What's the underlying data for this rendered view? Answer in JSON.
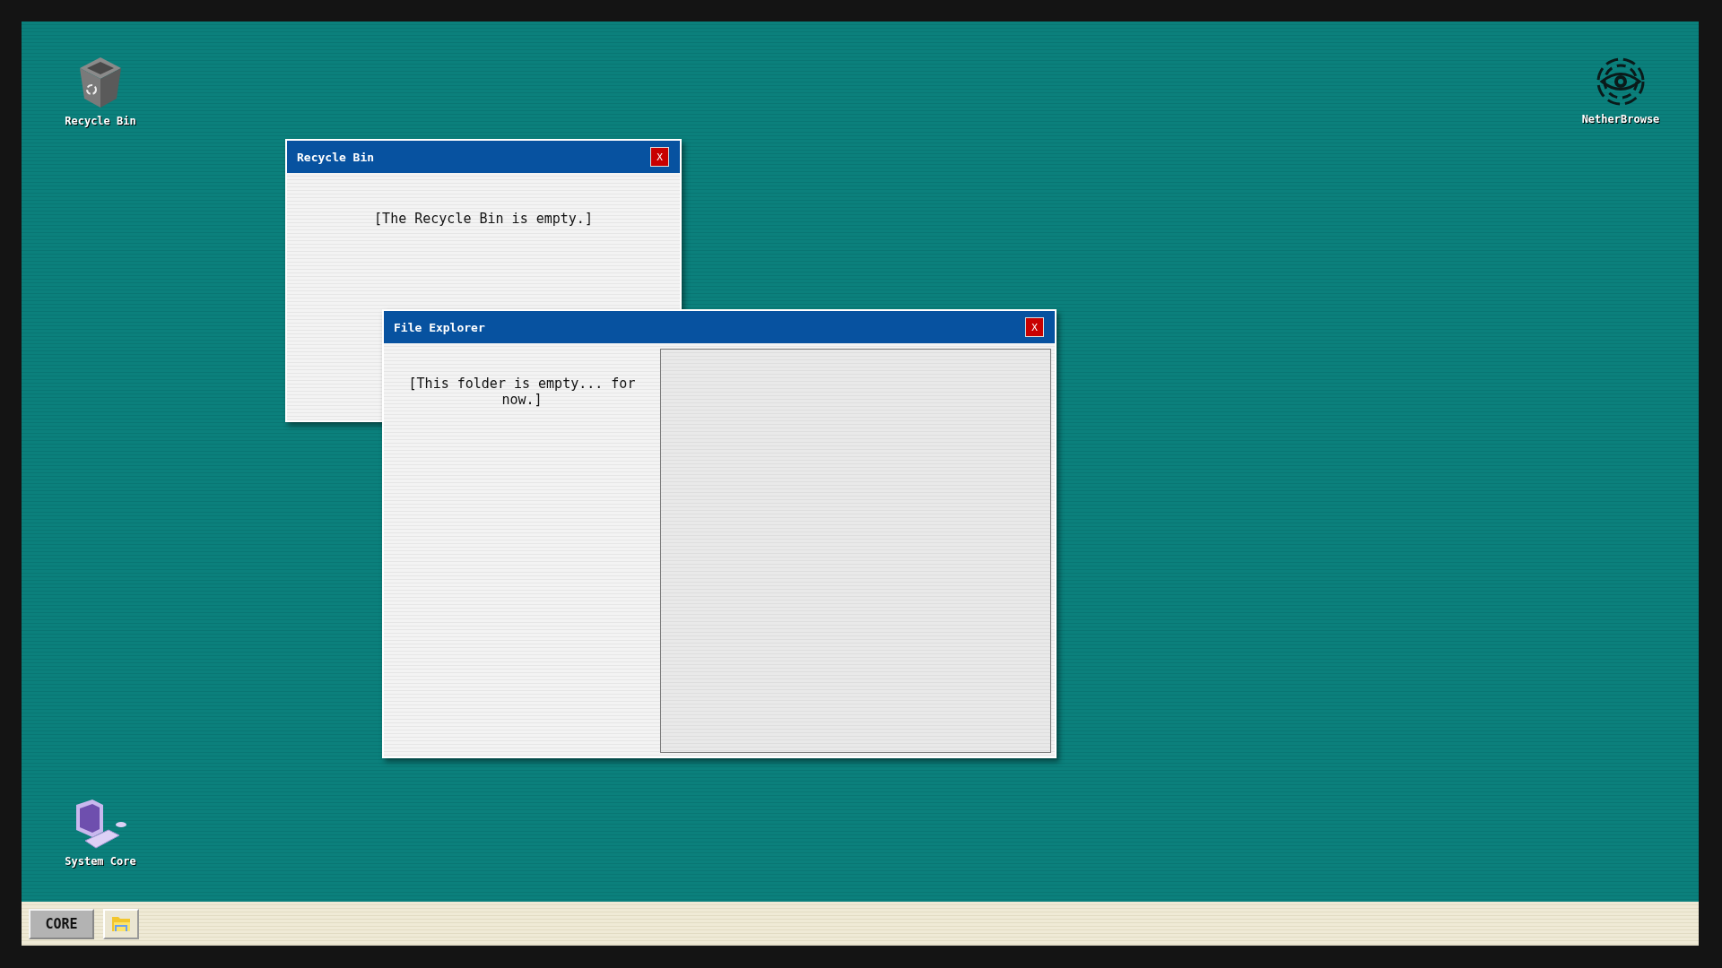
{
  "desktop_icons": [
    {
      "label": "Recycle Bin",
      "kind": "recycle-bin"
    },
    {
      "label": "NetherBrowse",
      "kind": "browser"
    },
    {
      "label": "System Core",
      "kind": "computer"
    }
  ],
  "windows": [
    {
      "title": "Recycle Bin",
      "kind": "recycle-bin",
      "message": "[The Recycle Bin is empty.]",
      "close": "X"
    },
    {
      "title": "File Explorer",
      "kind": "explorer",
      "message": "[This folder is empty... for now.]",
      "close": "X"
    }
  ],
  "taskbar": {
    "start_button": "CORE",
    "apps": [
      {
        "kind": "folder"
      }
    ]
  }
}
